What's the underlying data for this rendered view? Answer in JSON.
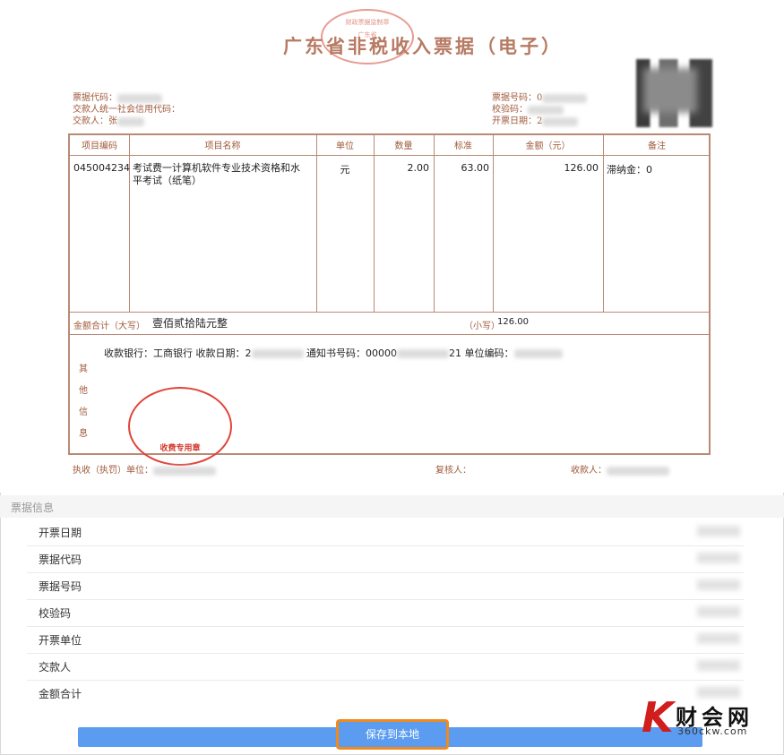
{
  "receipt": {
    "title": "广东省非税收入票据（电子）",
    "seal_text": "财政票据监制章",
    "seal_sub": "广东省",
    "left_meta": {
      "code_label": "票据代码：",
      "credit_label": "交款人统一社会信用代码：",
      "payer_label": "交款人：张"
    },
    "right_meta": {
      "number_label": "票据号码：0",
      "check_label": "校验码：",
      "date_label": "开票日期：2"
    },
    "columns": [
      "项目编码",
      "项目名称",
      "单位",
      "数量",
      "标准",
      "金额（元）",
      "备注"
    ],
    "row": {
      "code": "045004234",
      "name_line1": "考试费一计算机软件专业技术资格和水",
      "name_line2": "平考试（纸笔）",
      "unit": "元",
      "qty": "2.00",
      "std": "63.00",
      "amount": "126.00",
      "note": "滞纳金：0"
    },
    "total_label": "金额合计（大写）",
    "total_upper": "壹佰贰拾陆元整",
    "total_small_label": "（小写）",
    "total_small": "126.00",
    "other_info_label": [
      "其",
      "他",
      "信",
      "息"
    ],
    "other_info_line": {
      "bank": "收款银行：工商银行",
      "date": "收款日期：2",
      "notice": "通知书号码：00000",
      "notice_tail": "21",
      "unit_code": "单位编码："
    },
    "stamp_text": "收费专用章",
    "footer": {
      "collector": "执收（执罚）单位：",
      "reviewer": "复核人：",
      "payee": "收款人："
    }
  },
  "info": {
    "header": "票据信息",
    "rows": [
      {
        "label": "开票日期"
      },
      {
        "label": "票据代码"
      },
      {
        "label": "票据号码"
      },
      {
        "label": "校验码"
      },
      {
        "label": "开票单位"
      },
      {
        "label": "交款人"
      },
      {
        "label": "金额合计"
      }
    ]
  },
  "actions": {
    "save_label": "保存到本地"
  },
  "watermark": {
    "name": "财会网",
    "url": "360ckw.com"
  },
  "colors": {
    "receipt_ink": "#a05a3c",
    "stamp_red": "#d43a2f",
    "button_blue": "#5b9cf0",
    "highlight_orange": "#f08a1c"
  }
}
